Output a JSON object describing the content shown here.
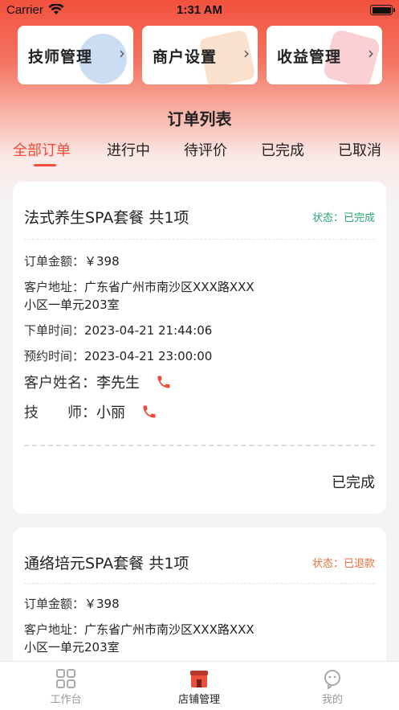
{
  "status_bar": {
    "carrier": "Carrier",
    "time": "1:31 AM"
  },
  "quick_cards": [
    {
      "label": "技师管理"
    },
    {
      "label": "商户设置"
    },
    {
      "label": "收益管理"
    }
  ],
  "list_title": "订单列表",
  "tabs": [
    {
      "label": "全部订单",
      "active": true
    },
    {
      "label": "进行中"
    },
    {
      "label": "待评价"
    },
    {
      "label": "已完成"
    },
    {
      "label": "已取消"
    }
  ],
  "orders": [
    {
      "title": "法式养生SPA套餐 共1项",
      "status": "状态：已完成",
      "amount_label": "订单金额：",
      "amount": "￥398",
      "address_label": "客户地址：",
      "address_line1": "广东省广州市南沙区XXX路XXX",
      "address_line2": "小区一单元203室",
      "order_time_label": "下单时间：",
      "order_time": "2023-04-21 21:44:06",
      "appoint_time_label": "预约时间：",
      "appoint_time": "2023-04-21 23:00:00",
      "customer_label": "客户姓名：",
      "customer": "李先生",
      "tech_label": "技　　师：",
      "tech": "小丽",
      "footer": "已完成"
    },
    {
      "title": "通络培元SPA套餐 共1项",
      "status": "状态：已退款",
      "amount_label": "订单金额：",
      "amount": "￥398",
      "address_label": "客户地址：",
      "address_line1": "广东省广州市南沙区XXX路XXX",
      "address_line2": "小区一单元203室"
    }
  ],
  "tabbar": [
    {
      "label": "工作台",
      "icon": "grid-icon"
    },
    {
      "label": "店铺管理",
      "icon": "shop-icon",
      "active": true
    },
    {
      "label": "我的",
      "icon": "profile-icon"
    }
  ],
  "colors": {
    "accent": "#ef4b36",
    "done": "#2aa872",
    "refund": "#ef6f3f"
  }
}
